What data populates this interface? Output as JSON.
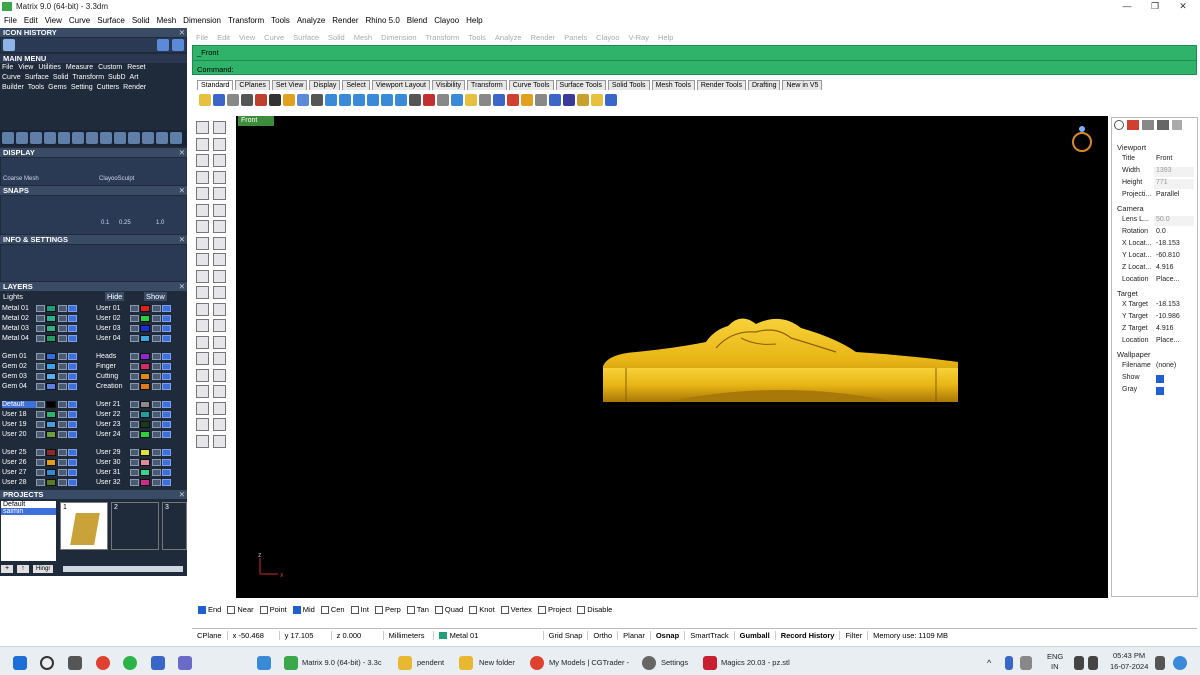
{
  "window": {
    "title": "Matrix 9.0 (64-bit) - 3.3dm",
    "min": "—",
    "max": "❐",
    "close": "✕"
  },
  "menubar": [
    "File",
    "Edit",
    "View",
    "Curve",
    "Surface",
    "Solid",
    "Mesh",
    "Dimension",
    "Transform",
    "Tools",
    "Analyze",
    "Render",
    "Rhino 5.0",
    "Blend",
    "Clayoo",
    "Help"
  ],
  "left": {
    "icon_history": "ICON HISTORY",
    "main_menu": "MAIN MENU",
    "main_menu_row1": [
      "File",
      "View",
      "Utilities",
      "Measure",
      "Custom",
      "Reset"
    ],
    "main_menu_row2": [
      "Curve",
      "Surface",
      "Solid",
      "Transform",
      "SubD",
      "Art"
    ],
    "main_menu_row3": [
      "Builder",
      "Tools",
      "Gems",
      "Setting",
      "Cutters",
      "Render"
    ],
    "display": "DISPLAY",
    "display_labels": [
      "Coarse Mesh",
      "ClayooSculpt"
    ],
    "snaps": "SNAPS",
    "snap_values": [
      "0.1",
      "0.25",
      "1.0"
    ],
    "info": "INFO & SETTINGS",
    "layers": "LAYERS",
    "lights": "Lights",
    "hide": "Hide",
    "show": "Show",
    "layer_groups": [
      {
        "left": [
          "Metal 01",
          "Metal 02",
          "Metal 03",
          "Metal 04"
        ],
        "right": [
          "User 01",
          "User 02",
          "User 03",
          "User 04"
        ],
        "lc": [
          "#1f9e7a",
          "#2db38a",
          "#35b07a",
          "#249c66"
        ],
        "rc": [
          "#e0201c",
          "#2bd13a",
          "#1a2fd6",
          "#38a8e0"
        ]
      },
      {
        "left": [
          "Gem 01",
          "Gem 02",
          "Gem 03",
          "Gem 04"
        ],
        "right": [
          "Heads",
          "Finger",
          "Cutting",
          "Creation"
        ],
        "lc": [
          "#2f6fe0",
          "#3aa0e8",
          "#55b0f0",
          "#5f7fe8"
        ],
        "rc": [
          "#8a2bd1",
          "#d12b6a",
          "#e08a1a",
          "#e07a1a"
        ]
      },
      {
        "left": [
          "Default",
          "User 18",
          "User 19",
          "User 20"
        ],
        "right": [
          "User 21",
          "User 22",
          "User 23",
          "User 24"
        ],
        "lc": [
          "#000000",
          "#2db36b",
          "#4a9ee0",
          "#6e9e40"
        ],
        "rc": [
          "#8a8a8a",
          "#1f9e9e",
          "#1a3a1a",
          "#2bd13a"
        ]
      },
      {
        "left": [
          "User 25",
          "User 26",
          "User 27",
          "User 28"
        ],
        "right": [
          "User 29",
          "User 30",
          "User 31",
          "User 32"
        ],
        "lc": [
          "#8a2b2b",
          "#e0a01a",
          "#2f8ad1",
          "#5a7a2a"
        ],
        "rc": [
          "#e0e03a",
          "#e08aa0",
          "#3ad18a",
          "#d12b8a"
        ]
      }
    ],
    "projects": "PROJECTS",
    "project_list": [
      "Default",
      "saimin"
    ],
    "project_slots": [
      "1",
      "2",
      "3"
    ],
    "hinge": "Hingr"
  },
  "main": {
    "ghost_menu": [
      "File",
      "Edit",
      "View",
      "Curve",
      "Surface",
      "Solid",
      "Mesh",
      "Dimension",
      "Transform",
      "Tools",
      "Analyze",
      "Render",
      "Panels",
      "Clayoo",
      "V-Ray",
      "Help"
    ],
    "cmd_history": "_Front",
    "cmd_prompt": "Command:",
    "tabs": [
      "Standard",
      "CPlanes",
      "Set View",
      "Display",
      "Select",
      "Viewport Layout",
      "Visibility",
      "Transform",
      "Curve Tools",
      "Surface Tools",
      "Solid Tools",
      "Mesh Tools",
      "Render Tools",
      "Drafting",
      "New in V5"
    ],
    "viewport_label": "Front",
    "axis_z": "z",
    "axis_x": "x",
    "osnap": [
      {
        "label": "End",
        "on": true
      },
      {
        "label": "Near",
        "on": false
      },
      {
        "label": "Point",
        "on": false
      },
      {
        "label": "Mid",
        "on": true
      },
      {
        "label": "Cen",
        "on": false
      },
      {
        "label": "Int",
        "on": false
      },
      {
        "label": "Perp",
        "on": false
      },
      {
        "label": "Tan",
        "on": false
      },
      {
        "label": "Quad",
        "on": false
      },
      {
        "label": "Knot",
        "on": false
      },
      {
        "label": "Vertex",
        "on": false
      },
      {
        "label": "Project",
        "on": false
      },
      {
        "label": "Disable",
        "on": false
      }
    ],
    "status": {
      "cplane": "CPlane",
      "x": "x -50.468",
      "y": "y 17.105",
      "z": "z 0.000",
      "units": "Millimeters",
      "layer": "Metal 01",
      "grid": "Grid Snap",
      "ortho": "Ortho",
      "planar": "Planar",
      "osnap": "Osnap",
      "smart": "SmartTrack",
      "gumball": "Gumball",
      "record": "Record History",
      "filter": "Filter",
      "memory": "Memory use: 1109 MB"
    }
  },
  "properties": {
    "viewport": "Viewport",
    "rows1": [
      {
        "k": "Title",
        "v": "Front",
        "dim": false
      },
      {
        "k": "Width",
        "v": "1393",
        "dim": true
      },
      {
        "k": "Height",
        "v": "771",
        "dim": true
      },
      {
        "k": "Projecti...",
        "v": "Parallel",
        "dim": false
      }
    ],
    "camera": "Camera",
    "rows2": [
      {
        "k": "Lens L...",
        "v": "50.0",
        "dim": true
      },
      {
        "k": "Rotation",
        "v": "0.0",
        "dim": false
      },
      {
        "k": "X Locat...",
        "v": "-18.153",
        "dim": false
      },
      {
        "k": "Y Locat...",
        "v": "-60.810",
        "dim": false
      },
      {
        "k": "Z Locat...",
        "v": "4.916",
        "dim": false
      },
      {
        "k": "Location",
        "v": "Place...",
        "dim": false
      }
    ],
    "target": "Target",
    "rows3": [
      {
        "k": "X Target",
        "v": "-18.153",
        "dim": false
      },
      {
        "k": "Y Target",
        "v": "-10.986",
        "dim": false
      },
      {
        "k": "Z Target",
        "v": "4.916",
        "dim": false
      },
      {
        "k": "Location",
        "v": "Place...",
        "dim": false
      }
    ],
    "wallpaper": "Wallpaper",
    "rows4": [
      {
        "k": "Filename",
        "v": "(none)",
        "dim": false
      }
    ],
    "show": "Show",
    "gray": "Gray"
  },
  "taskbar": {
    "items": [
      "Matrix 9.0 (64-bit) - 3.3c",
      "pendent",
      "New folder",
      "My Models | CGTrader -",
      "Settings",
      "Magics 20.03 - pz.stl"
    ],
    "lang1": "ENG",
    "lang2": "IN",
    "time": "05:43 PM",
    "date": "16-07-2024"
  }
}
